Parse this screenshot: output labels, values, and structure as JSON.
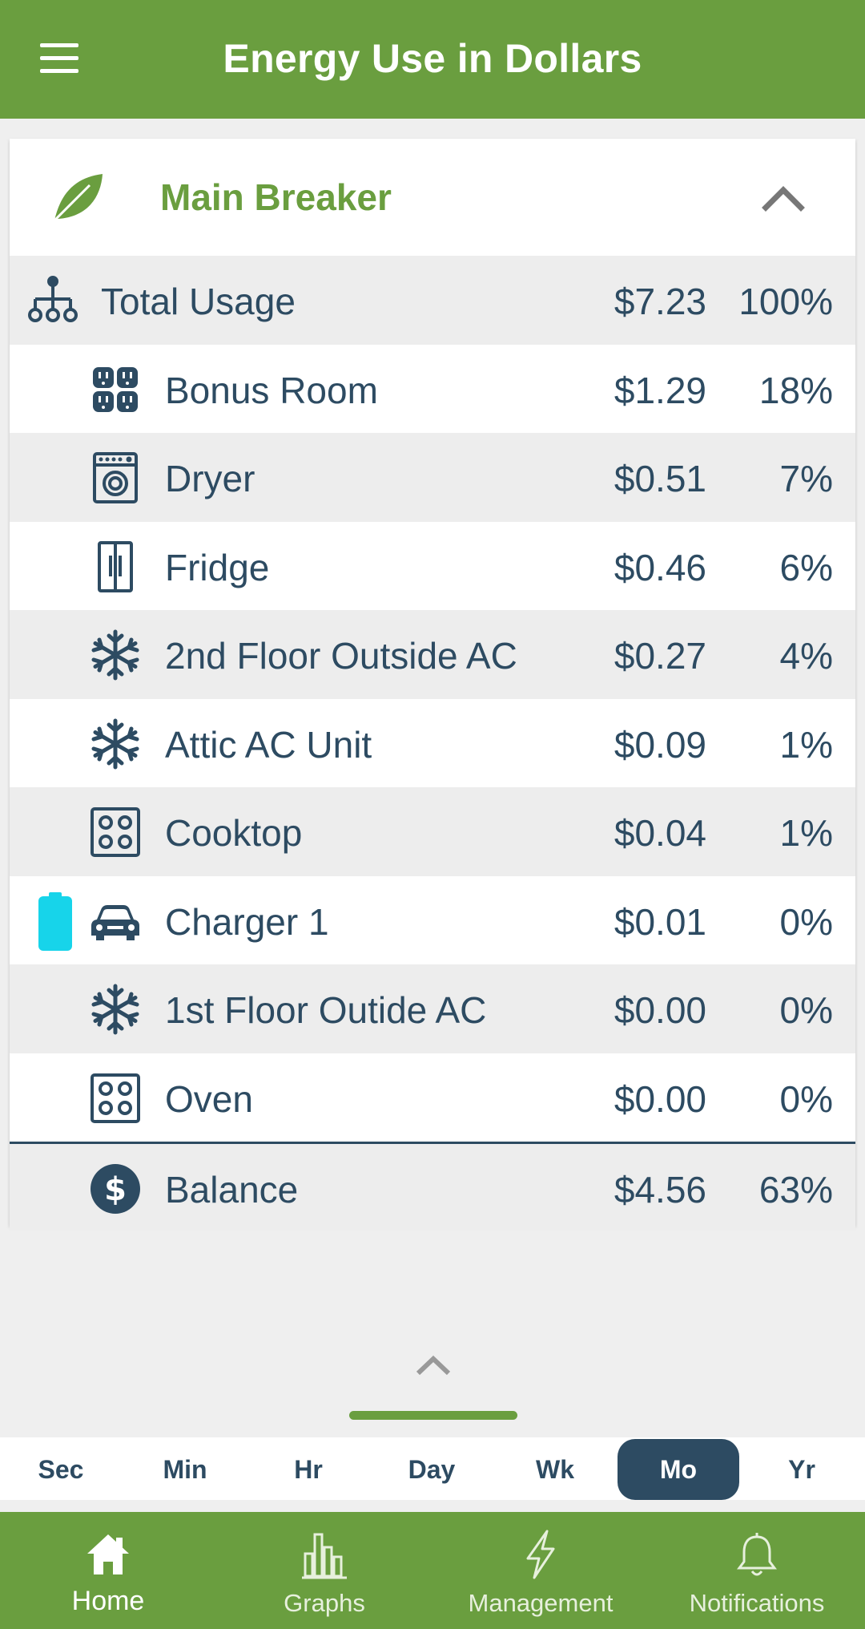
{
  "header": {
    "title": "Energy Use in Dollars"
  },
  "card": {
    "name": "Main Breaker"
  },
  "total": {
    "label": "Total Usage",
    "amount": "$7.23",
    "percent": "100%"
  },
  "circuits": [
    {
      "label": "Bonus Room",
      "amount": "$1.29",
      "percent": "18%",
      "icon": "outlet-icon"
    },
    {
      "label": "Dryer",
      "amount": "$0.51",
      "percent": "7%",
      "icon": "dryer-icon"
    },
    {
      "label": "Fridge",
      "amount": "$0.46",
      "percent": "6%",
      "icon": "fridge-icon"
    },
    {
      "label": "2nd Floor Outside AC",
      "amount": "$0.27",
      "percent": "4%",
      "icon": "snowflake-icon"
    },
    {
      "label": "Attic AC Unit",
      "amount": "$0.09",
      "percent": "1%",
      "icon": "snowflake-icon"
    },
    {
      "label": "Cooktop",
      "amount": "$0.04",
      "percent": "1%",
      "icon": "cooktop-icon"
    },
    {
      "label": "Charger 1",
      "amount": "$0.01",
      "percent": "0%",
      "icon": "car-icon"
    },
    {
      "label": "1st Floor Outide AC",
      "amount": "$0.00",
      "percent": "0%",
      "icon": "snowflake-icon"
    },
    {
      "label": "Oven",
      "amount": "$0.00",
      "percent": "0%",
      "icon": "cooktop-icon"
    }
  ],
  "balance": {
    "label": "Balance",
    "amount": "$4.56",
    "percent": "63%"
  },
  "time_ranges": {
    "items": [
      "Sec",
      "Min",
      "Hr",
      "Day",
      "Wk",
      "Mo",
      "Yr"
    ],
    "selected": "Mo"
  },
  "nav": {
    "home": "Home",
    "graphs": "Graphs",
    "management": "Management",
    "notifications": "Notifications"
  },
  "colors": {
    "brand_green": "#6a9e3f",
    "navy": "#2d4b62",
    "battery_cyan": "#17d4ea"
  }
}
